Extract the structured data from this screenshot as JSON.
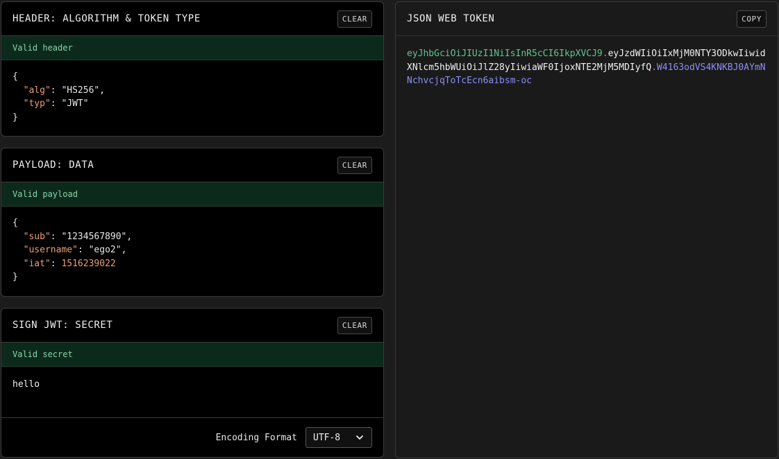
{
  "header_panel": {
    "title": "HEADER: ALGORITHM & TOKEN TYPE",
    "clear_label": "CLEAR",
    "status": "Valid header",
    "json": {
      "open": "{",
      "close": "}",
      "fields": [
        {
          "key": "\"alg\"",
          "value": "\"HS256\"",
          "sep": ": ",
          "trail": ","
        },
        {
          "key": "\"typ\"",
          "value": "\"JWT\"",
          "sep": ": ",
          "trail": ""
        }
      ]
    }
  },
  "payload_panel": {
    "title": "PAYLOAD: DATA",
    "clear_label": "CLEAR",
    "status": "Valid payload",
    "json": {
      "open": "{",
      "close": "}",
      "fields": [
        {
          "key": "\"sub\"",
          "value": "\"1234567890\"",
          "sep": ": ",
          "trail": ","
        },
        {
          "key": "\"username\"",
          "value": "\"ego2\"",
          "sep": ": ",
          "trail": ","
        },
        {
          "key": "\"iat\"",
          "value": "1516239022",
          "sep": ": ",
          "trail": ""
        }
      ]
    }
  },
  "secret_panel": {
    "title": "SIGN JWT: SECRET",
    "clear_label": "CLEAR",
    "status": "Valid secret",
    "value": "hello",
    "encoding_label": "Encoding Format",
    "encoding_value": "UTF-8"
  },
  "token_panel": {
    "title": "JSON WEB TOKEN",
    "copy_label": "COPY",
    "header_part": "eyJhbGciOiJIUzI1NiIsInR5cCI6IkpXVCJ9",
    "dot": ".",
    "payload_part": "eyJzdWIiOiIxMjM0NTY3ODkwIiwidXNlcm5hbWUiOiJlZ28yIiwiaWF0IjoxNTE2MjM5MDIyfQ",
    "signature_part": "W4163odVS4KNKBJ0AYmNNchvcjqToTcEcn6aibsm-oc"
  },
  "colors": {
    "header_segment": "#5fc592",
    "payload_segment": "#f0f0f0",
    "signature_segment": "#8f8ef6",
    "dot": "#e86f9f",
    "status_bg": "#0c2a1c",
    "json_key": "#ec9d74"
  }
}
